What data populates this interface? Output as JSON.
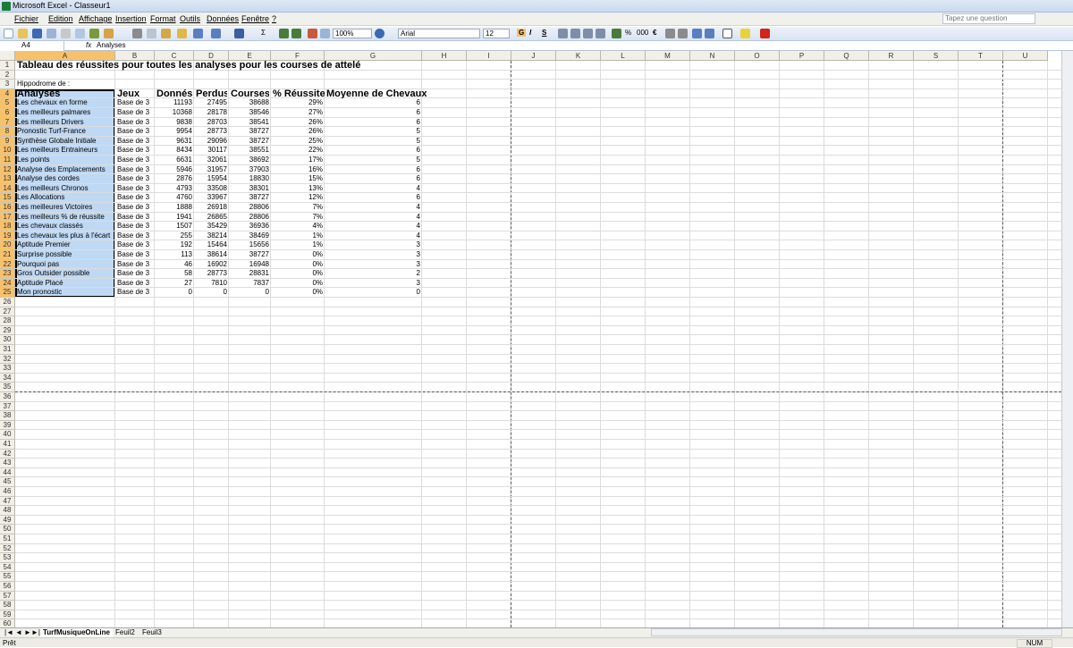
{
  "window": {
    "title": "Microsoft Excel - Classeur1"
  },
  "menu": [
    "Fichier",
    "Edition",
    "Affichage",
    "Insertion",
    "Format",
    "Outils",
    "Données",
    "Fenêtre",
    "?"
  ],
  "help_placeholder": "Tapez une question",
  "toolbar": {
    "zoom": "100%",
    "font": "Arial",
    "size": "12",
    "bold": "G",
    "italic": "I",
    "underline": "S",
    "percent": "%",
    "thousands": "000",
    "euro": "€"
  },
  "formula_bar": {
    "name_box": "A4",
    "fx": "fx",
    "content": "Analyses"
  },
  "columns": [
    "A",
    "B",
    "C",
    "D",
    "E",
    "F",
    "G",
    "H",
    "I",
    "J",
    "K",
    "L",
    "M",
    "N",
    "O",
    "P",
    "Q",
    "R",
    "S",
    "T",
    "U"
  ],
  "sheet": {
    "title": "Tableau des réussites pour toutes les analyses pour les courses de attelé",
    "hippodrome": "Hippodrome de :",
    "headers": [
      "Analyses",
      "Jeux",
      "Donnés",
      "Perdus",
      "Courses",
      "% Réussite",
      "Moyenne de Chevaux"
    ],
    "rows": [
      [
        "Les chevaux en forme",
        "Base de 3",
        "11193",
        "27495",
        "38688",
        "29%",
        "6"
      ],
      [
        "Les meilleurs palmares",
        "Base de 3",
        "10368",
        "28178",
        "38546",
        "27%",
        "6"
      ],
      [
        "Les meilleurs  Drivers",
        "Base de 3",
        "9838",
        "28703",
        "38541",
        "26%",
        "6"
      ],
      [
        "Pronostic Turf-France",
        "Base de 3",
        "9954",
        "28773",
        "38727",
        "26%",
        "5"
      ],
      [
        "Synthèse Globale Initiale",
        "Base de 3",
        "9631",
        "29096",
        "38727",
        "25%",
        "5"
      ],
      [
        "Les meilleurs Entraineurs",
        "Base de 3",
        "8434",
        "30117",
        "38551",
        "22%",
        "6"
      ],
      [
        "Les points",
        "Base de 3",
        "6631",
        "32061",
        "38692",
        "17%",
        "5"
      ],
      [
        "Analyse des Emplacements",
        "Base de 3",
        "5946",
        "31957",
        "37903",
        "16%",
        "6"
      ],
      [
        "Analyse des cordes",
        "Base de 3",
        "2876",
        "15954",
        "18830",
        "15%",
        "6"
      ],
      [
        "Les meilleurs Chronos",
        "Base de 3",
        "4793",
        "33508",
        "38301",
        "13%",
        "4"
      ],
      [
        "Les Allocations",
        "Base de 3",
        "4760",
        "33967",
        "38727",
        "12%",
        "6"
      ],
      [
        "Les meilleures Victoires",
        "Base de 3",
        "1888",
        "26918",
        "28806",
        "7%",
        "4"
      ],
      [
        "Les meilleurs % de réussite",
        "Base de 3",
        "1941",
        "26865",
        "28806",
        "7%",
        "4"
      ],
      [
        "Les chevaux classés",
        "Base de 3",
        "1507",
        "35429",
        "36936",
        "4%",
        "4"
      ],
      [
        "Les chevaux les plus à l'écart",
        "Base de 3",
        "255",
        "38214",
        "38469",
        "1%",
        "4"
      ],
      [
        "Aptitude Premier",
        "Base de 3",
        "192",
        "15464",
        "15656",
        "1%",
        "3"
      ],
      [
        "Surprise possible",
        "Base de 3",
        "113",
        "38614",
        "38727",
        "0%",
        "3"
      ],
      [
        "Pourquoi pas",
        "Base de 3",
        "46",
        "16902",
        "16948",
        "0%",
        "3"
      ],
      [
        "Gros Outsider possible",
        "Base de 3",
        "58",
        "28773",
        "28831",
        "0%",
        "2"
      ],
      [
        "Aptitude Placé",
        "Base de 3",
        "27",
        "7810",
        "7837",
        "0%",
        "3"
      ],
      [
        "Mon pronostic",
        "Base de 3",
        "0",
        "0",
        "0",
        "0%",
        "0"
      ]
    ]
  },
  "tabs": [
    "TurfMusiqueOnLine",
    "Feuil2",
    "Feuil3"
  ],
  "status": {
    "left": "Prêt",
    "num": "NUM"
  },
  "colors": {
    "selection": "#bfd9f5",
    "header_selected": "#f7c16c"
  }
}
